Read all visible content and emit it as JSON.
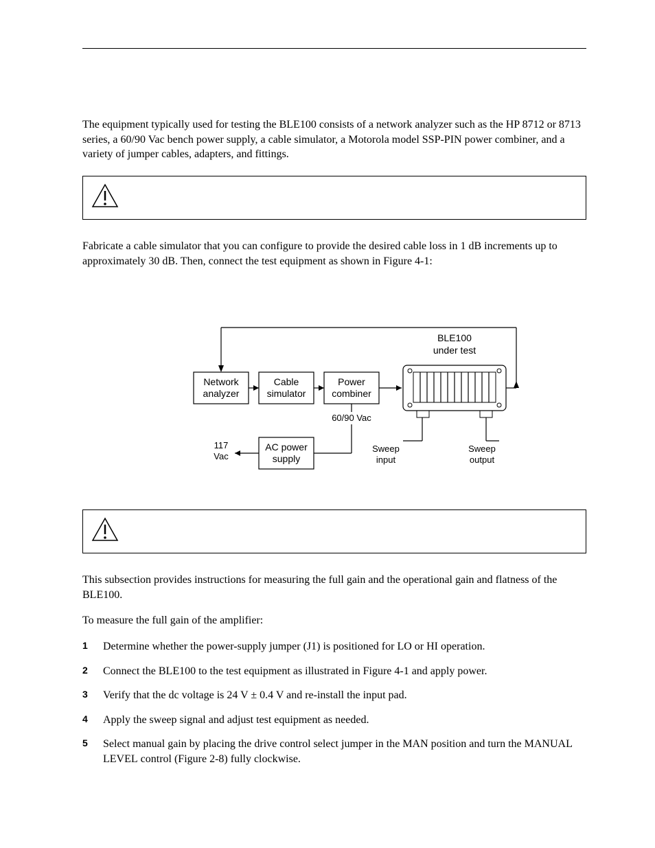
{
  "intro": "The equipment typically used for testing the BLE100 consists of a network analyzer such as the HP 8712 or 8713 series, a 60/90 Vac bench power supply, a cable simulator, a Motorola model SSP-PIN power combiner, and a variety of jumper cables, adapters, and fittings.",
  "fabricate": "Fabricate a cable simulator that you can configure to provide the desired cable loss in 1 dB increments up to approximately 30 dB. Then, connect the test equipment as shown in Figure 4-1:",
  "diagram": {
    "network_analyzer": "Network\nanalyzer",
    "cable_simulator": "Cable\nsimulator",
    "power_combiner": "Power\ncombiner",
    "ac_power_supply": "AC power\nsupply",
    "ble_under_test": "BLE100\nunder test",
    "sweep_input": "Sweep\ninput",
    "sweep_output": "Sweep\noutput",
    "vac_117": "117\nVac",
    "vac_6090": "60/90 Vac"
  },
  "gain_intro": "This subsection provides instructions for measuring the full gain and the operational gain and flatness of the BLE100.",
  "gain_lead": "To measure the full gain of the amplifier:",
  "steps": [
    {
      "n": "1",
      "text_pre": "Determine whether the power-supply jumper (J1) is positioned for ",
      "sc1": "LO",
      "mid": " or ",
      "sc2": "HI",
      "text_post": " operation."
    },
    {
      "n": "2",
      "text": "Connect the BLE100 to the test equipment as illustrated in Figure 4-1 and apply power."
    },
    {
      "n": "3",
      "text": "Verify that the dc voltage is 24 V ± 0.4 V and re-install the input pad."
    },
    {
      "n": "4",
      "text": "Apply the sweep signal and adjust test equipment as needed."
    },
    {
      "n": "5",
      "text_pre": "Select manual gain by placing the drive control select jumper in the ",
      "sc1": "MAN",
      "mid": " position and turn the ",
      "sc2": "MANUAL LEVEL",
      "text_post": " control (Figure 2-8) fully clockwise."
    }
  ]
}
